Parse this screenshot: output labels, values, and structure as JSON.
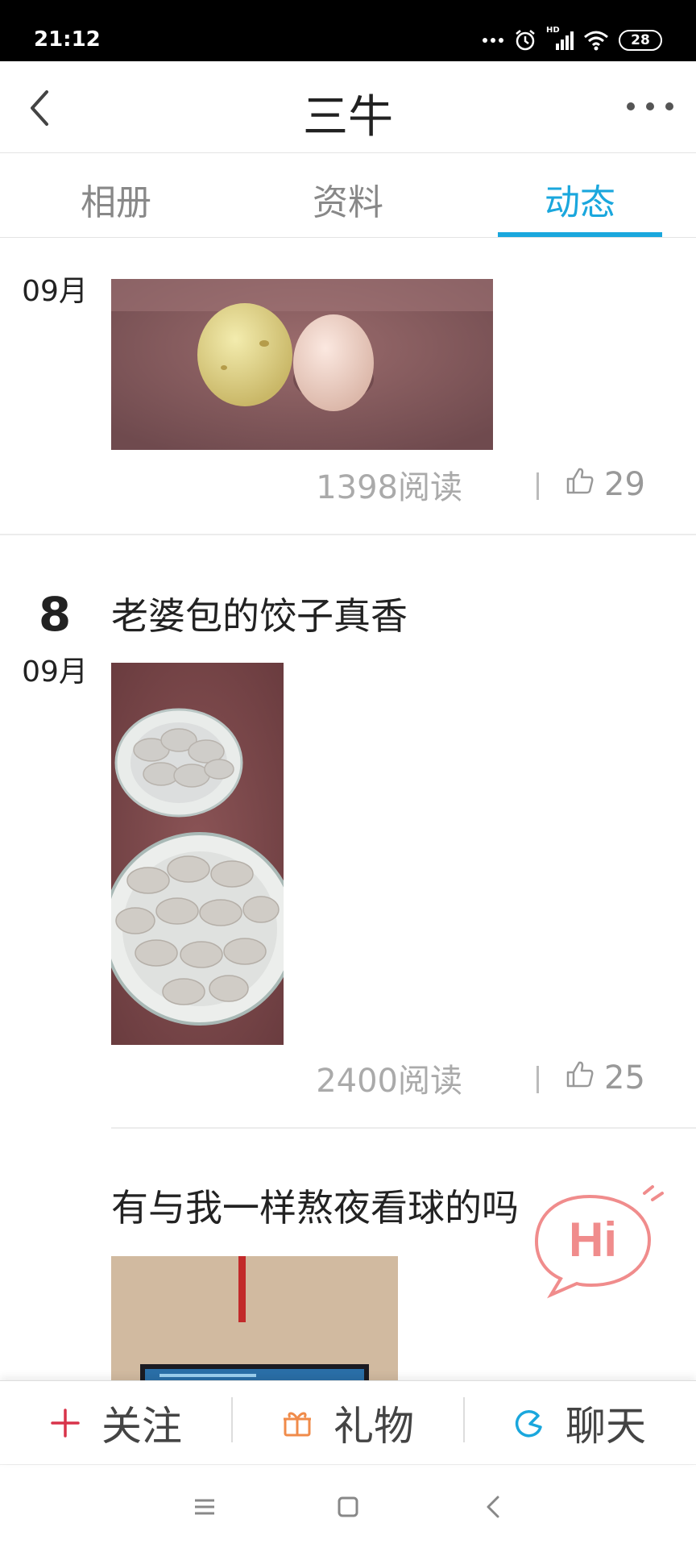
{
  "status_bar": {
    "time": "21:12",
    "battery": "28",
    "network": "HD"
  },
  "header": {
    "title": "三牛"
  },
  "tabs": [
    {
      "label": "相册",
      "active": false
    },
    {
      "label": "资料",
      "active": false
    },
    {
      "label": "动态",
      "active": true
    }
  ],
  "posts": [
    {
      "day": "",
      "month": "09月",
      "title": "",
      "reads": "1398阅读",
      "likes": "29"
    },
    {
      "day": "8",
      "month": "09月",
      "title": "老婆包的饺子真香",
      "reads": "2400阅读",
      "likes": "25"
    },
    {
      "day": "",
      "month": "",
      "title": "有与我一样熬夜看球的吗",
      "reads": "",
      "likes": ""
    }
  ],
  "hi_bubble": {
    "text": "Hi"
  },
  "action_bar": {
    "follow_label": "关注",
    "gift_label": "礼物",
    "chat_label": "聊天"
  },
  "colors": {
    "accent": "#1aa7dd",
    "follow": "#d8334a",
    "gift": "#f08b4a",
    "chat": "#1aa7dd",
    "hi": "#f08c8c"
  },
  "icons": [
    "back-arrow-icon",
    "more-dots-icon",
    "thumbs-up-icon",
    "plus-icon",
    "gift-icon",
    "chat-icon",
    "menu-icon",
    "home-icon",
    "nav-back-icon"
  ]
}
